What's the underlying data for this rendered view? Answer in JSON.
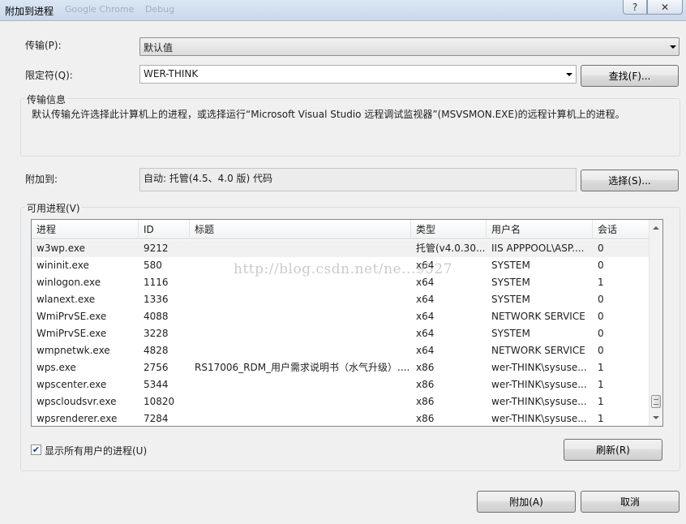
{
  "window": {
    "title": "附加到进程",
    "title_ghost": [
      "Google Chrome",
      "Debug"
    ],
    "help_glyph": "?",
    "close_glyph": "✕"
  },
  "transport": {
    "label": "传输(P):",
    "value": "默认值"
  },
  "qualifier": {
    "label": "限定符(Q):",
    "value": "WER-THINK",
    "find_button": "查找(F)..."
  },
  "transport_info": {
    "title": "传输信息",
    "text": "默认传输允许选择此计算机上的进程，或选择运行“Microsoft Visual Studio 远程调试监视器”(MSVSMON.EXE)的远程计算机上的进程。"
  },
  "attach_to": {
    "label": "附加到:",
    "value": "自动: 托管(4.5、4.0 版) 代码",
    "select_button": "选择(S)..."
  },
  "processes": {
    "title": "可用进程(V)",
    "columns": [
      "进程",
      "ID",
      "标题",
      "类型",
      "用户名",
      "会话"
    ],
    "rows": [
      {
        "process": "w3wp.exe",
        "id": "9212",
        "title": "",
        "type": "托管(v4.0.30...",
        "user": "IIS APPPOOL\\ASP....",
        "session": "0"
      },
      {
        "process": "wininit.exe",
        "id": "580",
        "title": "",
        "type": "x64",
        "user": "SYSTEM",
        "session": "0"
      },
      {
        "process": "winlogon.exe",
        "id": "1116",
        "title": "",
        "type": "x64",
        "user": "SYSTEM",
        "session": "1"
      },
      {
        "process": "wlanext.exe",
        "id": "1336",
        "title": "",
        "type": "x64",
        "user": "SYSTEM",
        "session": "0"
      },
      {
        "process": "WmiPrvSE.exe",
        "id": "4088",
        "title": "",
        "type": "x64",
        "user": "NETWORK SERVICE",
        "session": "0"
      },
      {
        "process": "WmiPrvSE.exe",
        "id": "3228",
        "title": "",
        "type": "x64",
        "user": "SYSTEM",
        "session": "0"
      },
      {
        "process": "wmpnetwk.exe",
        "id": "4828",
        "title": "",
        "type": "x64",
        "user": "NETWORK SERVICE",
        "session": "0"
      },
      {
        "process": "wps.exe",
        "id": "2756",
        "title": "RS17006_RDM_用户需求说明书（水气升级）....",
        "type": "x86",
        "user": "wer-THINK\\sysuse...",
        "session": "1"
      },
      {
        "process": "wpscenter.exe",
        "id": "5344",
        "title": "",
        "type": "x86",
        "user": "wer-THINK\\sysuse...",
        "session": "1"
      },
      {
        "process": "wpscloudsvr.exe",
        "id": "10820",
        "title": "",
        "type": "x86",
        "user": "wer-THINK\\sysuse...",
        "session": "1"
      },
      {
        "process": "wpsrenderer.exe",
        "id": "7284",
        "title": "",
        "type": "x86",
        "user": "wer-THINK\\sysuse...",
        "session": "1"
      }
    ],
    "show_all_users_label": "显示所有用户的进程(U)",
    "show_all_users_checked": true,
    "refresh_button": "刷新(R)"
  },
  "footer": {
    "attach_button": "附加(A)",
    "cancel_button": "取消"
  },
  "watermark": "http://blog.csdn.net/ne...9527"
}
